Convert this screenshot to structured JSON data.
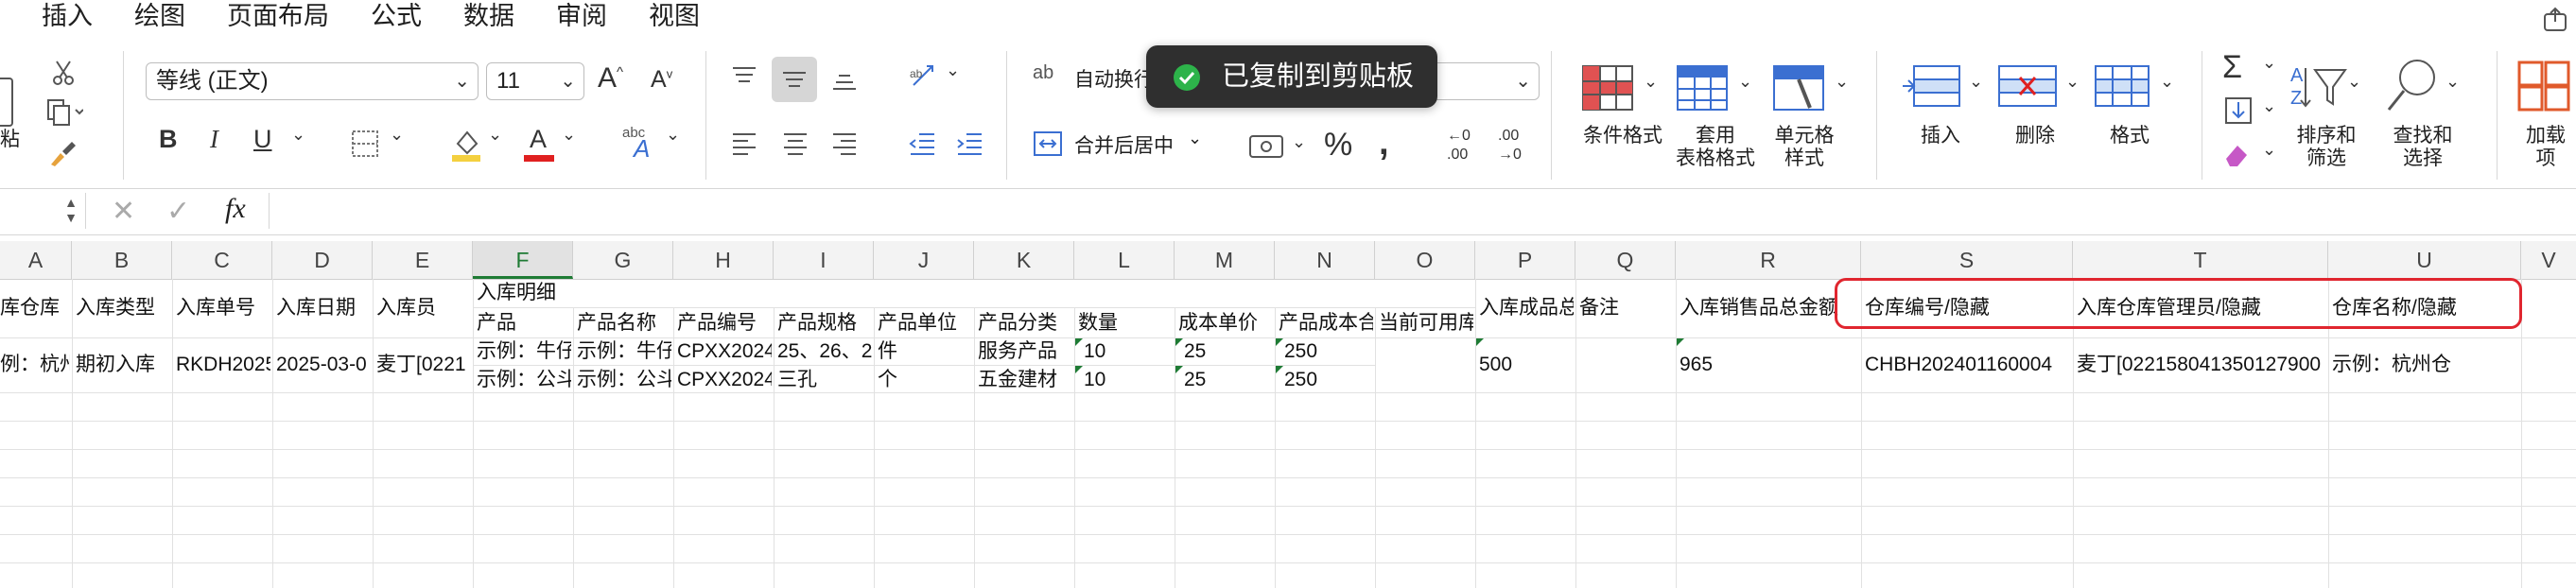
{
  "menu": [
    "插入",
    "绘图",
    "页面布局",
    "公式",
    "数据",
    "审阅",
    "视图"
  ],
  "ribbon": {
    "paste_label": "粘",
    "font_name": "等线 (正文)",
    "font_size": "11",
    "wrap_text_label": "自动换行",
    "merge_center_label": "合并后居中",
    "cond_format_label": "条件格式",
    "table_format_label": "套用\n表格格式",
    "cell_style_label": "单元格\n样式",
    "insert_label": "插入",
    "delete_label": "删除",
    "format_label": "格式",
    "sort_filter_label": "排序和\n筛选",
    "find_select_label": "查找和\n选择",
    "addins_label": "加载\n项",
    "bold": "B",
    "italic": "I",
    "underline": "U",
    "increase_font": "A",
    "decrease_font": "A",
    "percent": "%",
    "comma": ",",
    "inc_decimal": "←0\n.00",
    "dec_decimal": ".00\n→0"
  },
  "toast": {
    "text": "已复制到剪贴板",
    "accent": "#2db34a"
  },
  "formula_bar": {
    "fx_label": "fx",
    "value": ""
  },
  "columns": [
    "A",
    "B",
    "C",
    "D",
    "E",
    "F",
    "G",
    "H",
    "I",
    "J",
    "K",
    "L",
    "M",
    "N",
    "O",
    "P",
    "Q",
    "R",
    "S",
    "T",
    "U",
    "V"
  ],
  "rows": {
    "row1": {
      "F_group": "入库明细",
      "A": "库仓库",
      "B": "入库类型",
      "C": "入库单号",
      "D": "入库日期",
      "E": "入库员",
      "F": "产品",
      "G": "产品名称",
      "H": "产品编号",
      "I": "产品规格",
      "J": "产品单位",
      "K": "产品分类",
      "L": "数量",
      "M": "成本单价",
      "N": "产品成本合计",
      "O": "当前可用库存",
      "P": "入库成品总额",
      "Q": "备注",
      "R": "入库销售品总金额",
      "S": "仓库编号/隐藏",
      "T": "入库仓库管理员/隐藏",
      "U": "仓库名称/隐藏"
    },
    "row2": {
      "A": "例：杭州",
      "B": "期初入库",
      "C": "RKDH2025",
      "D": "2025-03-0",
      "E": "麦丁[0221",
      "F1": "示例：牛仔",
      "G1": "示例：牛仔",
      "H1": "CPXX2024",
      "I1": "25、26、2",
      "J1": "件",
      "K1": "服务产品",
      "L1": "10",
      "M1": "25",
      "N1": "250",
      "F2": "示例：公斗",
      "G2": "示例：公斗",
      "H2": "CPXX2024",
      "I2": "三孔",
      "J2": "个",
      "K2": "五金建材",
      "L2": "10",
      "M2": "25",
      "N2": "250",
      "P": "500",
      "R": "965",
      "S": "CHBH202401160004",
      "T": "麦丁[022158041350127900",
      "U": "示例：杭州仓"
    }
  },
  "colors": {
    "highlight_box": "#e0262f",
    "fill_yellow": "#f4d03f",
    "font_red": "#e02020",
    "green_flag": "#1e7b34"
  }
}
